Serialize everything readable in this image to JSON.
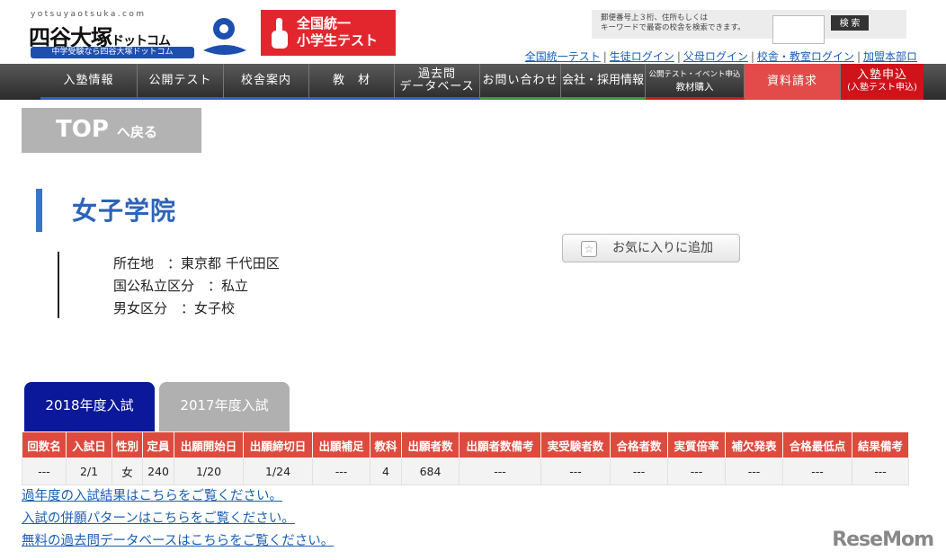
{
  "header": {
    "domain_text": "yotsuyaotsuka.com",
    "logo_title": "四谷大塚",
    "logo_suffix": "ドットコム",
    "logo_tagline": "中学受験なら四谷大塚ドットコム",
    "banner_line1": "全国統一",
    "banner_line2": "小学生テスト",
    "search_hint_line1": "郵便番号上３桁、住所もしくは",
    "search_hint_line2": "キーワードで最寄の校舎を検索できます。",
    "search_value": "",
    "search_button": "検 索",
    "top_links": [
      "全国統一テスト",
      "生徒ログイン",
      "父母ログイン",
      "校舎・教室ログイン",
      "加盟本部ロ"
    ]
  },
  "nav": {
    "items": [
      {
        "label": "入塾情報"
      },
      {
        "label": "公開テスト"
      },
      {
        "label": "校舎案内"
      },
      {
        "label": "教　材"
      },
      {
        "line1": "過去問",
        "line2": "データベース"
      },
      {
        "label": "お問い合わせ"
      },
      {
        "label": "会社・採用情報"
      },
      {
        "line1": "公開テスト・イベント申込",
        "line2": "教材購入"
      },
      {
        "label": "資料請求"
      },
      {
        "line1": "入塾申込",
        "line2": "(入塾テスト申込)"
      }
    ]
  },
  "top_back": {
    "main": "TOP",
    "sub": "へ戻る"
  },
  "school": {
    "name": "女子学院",
    "info": [
      {
        "label": "所在地　：",
        "value": "東京都 千代田区"
      },
      {
        "label": "国公私立区分　：",
        "value": "私立"
      },
      {
        "label": "男女区分　：",
        "value": "女子校"
      }
    ],
    "favorite_button": "お気に入りに追加"
  },
  "tabs": {
    "active": "2018年度入試",
    "inactive": "2017年度入試"
  },
  "table": {
    "headers": [
      "回数名",
      "入試日",
      "性別",
      "定員",
      "出願開始日",
      "出願締切日",
      "出願補足",
      "教科",
      "出願者数",
      "出願者数備考",
      "実受験者数",
      "合格者数",
      "実質倍率",
      "補欠発表",
      "合格最低点",
      "結果備考"
    ],
    "rows": [
      [
        "---",
        "2/1",
        "女",
        "240",
        "1/20",
        "1/24",
        "---",
        "4",
        "684",
        "---",
        "---",
        "---",
        "---",
        "---",
        "---",
        "---"
      ]
    ]
  },
  "links": [
    "過年度の入試結果はこちらをご覧ください。",
    "入試の併願パターンはこちらをご覧ください。",
    "無料の過去問データベースはこちらをご覧ください。"
  ],
  "watermark": "ReseMom"
}
